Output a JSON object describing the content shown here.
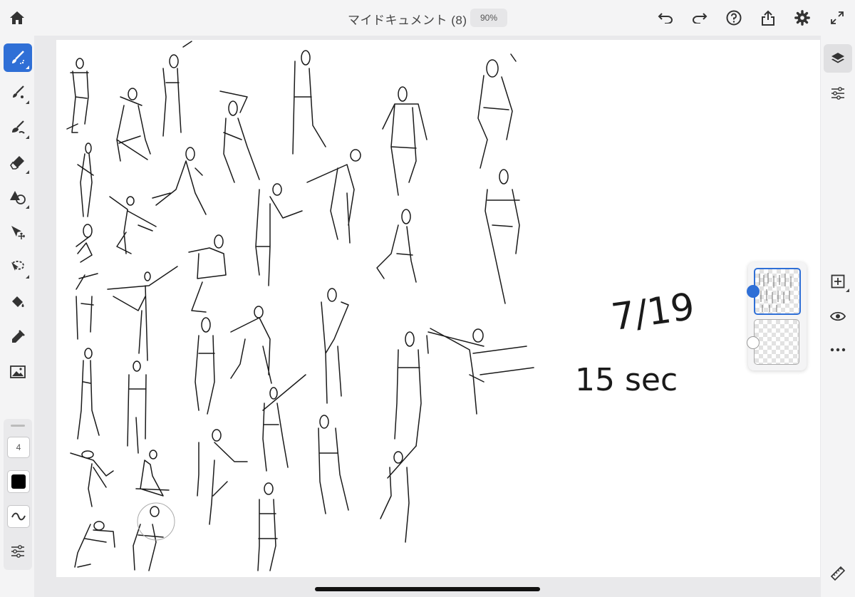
{
  "header": {
    "doc_title": "マイドキュメント (8)",
    "zoom": "90%"
  },
  "toolbar": {
    "brush_size": "4",
    "active_tool": "paint-brush",
    "color": "#000000",
    "accent": "#2f6fd6"
  },
  "canvas": {
    "date_note": "7/19",
    "time_note": "15 sec"
  },
  "layers": {
    "count": 2,
    "selected_index": 0
  },
  "icons": {
    "top_left": [
      "home-icon"
    ],
    "top_right": [
      "undo-icon",
      "redo-icon",
      "help-icon",
      "share-icon",
      "settings-icon",
      "fullscreen-icon"
    ],
    "left": [
      "paint-brush-icon",
      "watercolor-brush-icon",
      "live-oil-icon",
      "eraser-icon",
      "shape-icon",
      "transform-icon",
      "lasso-icon",
      "fill-icon",
      "eyedropper-icon",
      "image-icon",
      "brush-settings-icon",
      "smoothing-icon",
      "options-icon"
    ],
    "right": [
      "layers-icon",
      "adjust-icon",
      "add-layer-icon",
      "visibility-icon",
      "more-icon",
      "ruler-icon"
    ]
  }
}
